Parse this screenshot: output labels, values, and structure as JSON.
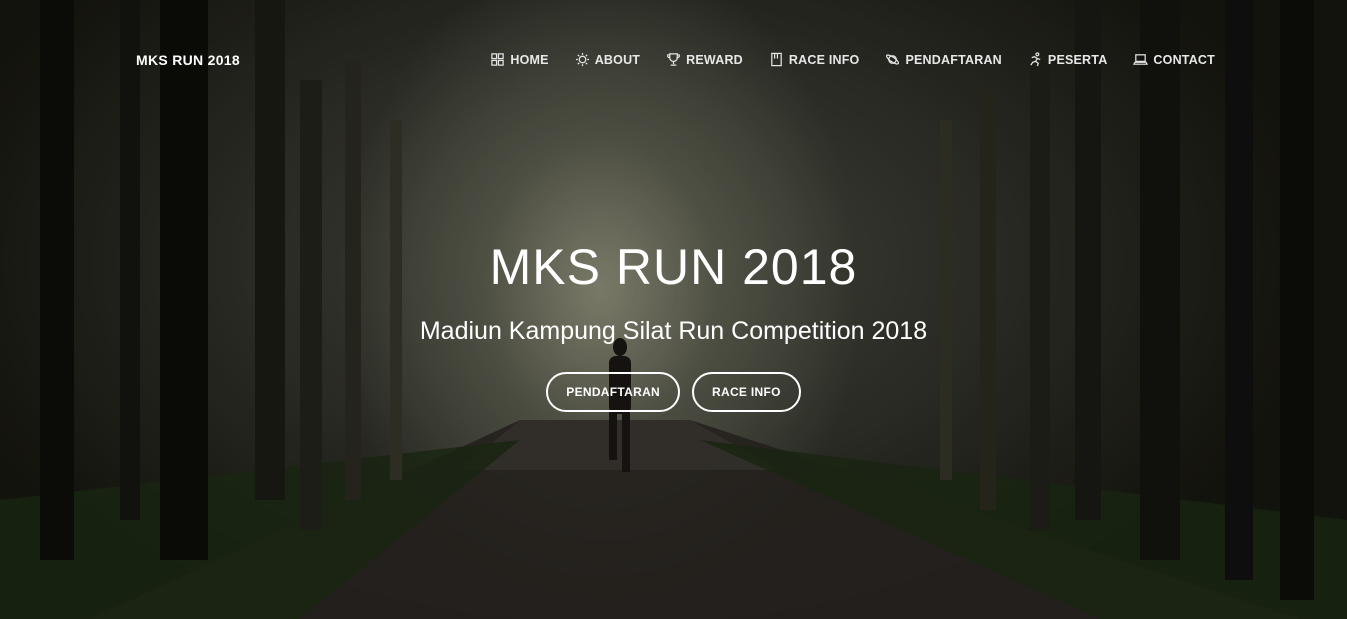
{
  "brand": "MKS RUN 2018",
  "nav": [
    {
      "label": "HOME",
      "icon": "grid-icon"
    },
    {
      "label": "ABOUT",
      "icon": "lightbulb-icon"
    },
    {
      "label": "REWARD",
      "icon": "trophy-icon"
    },
    {
      "label": "RACE INFO",
      "icon": "book-icon"
    },
    {
      "label": "PENDAFTARAN",
      "icon": "planet-icon"
    },
    {
      "label": "PESERTA",
      "icon": "runner-icon"
    },
    {
      "label": "CONTACT",
      "icon": "laptop-icon"
    }
  ],
  "hero": {
    "title": "MKS RUN 2018",
    "subtitle": "Madiun Kampung Silat Run Competition 2018",
    "buttons": [
      "PENDAFTARAN",
      "RACE INFO"
    ]
  }
}
